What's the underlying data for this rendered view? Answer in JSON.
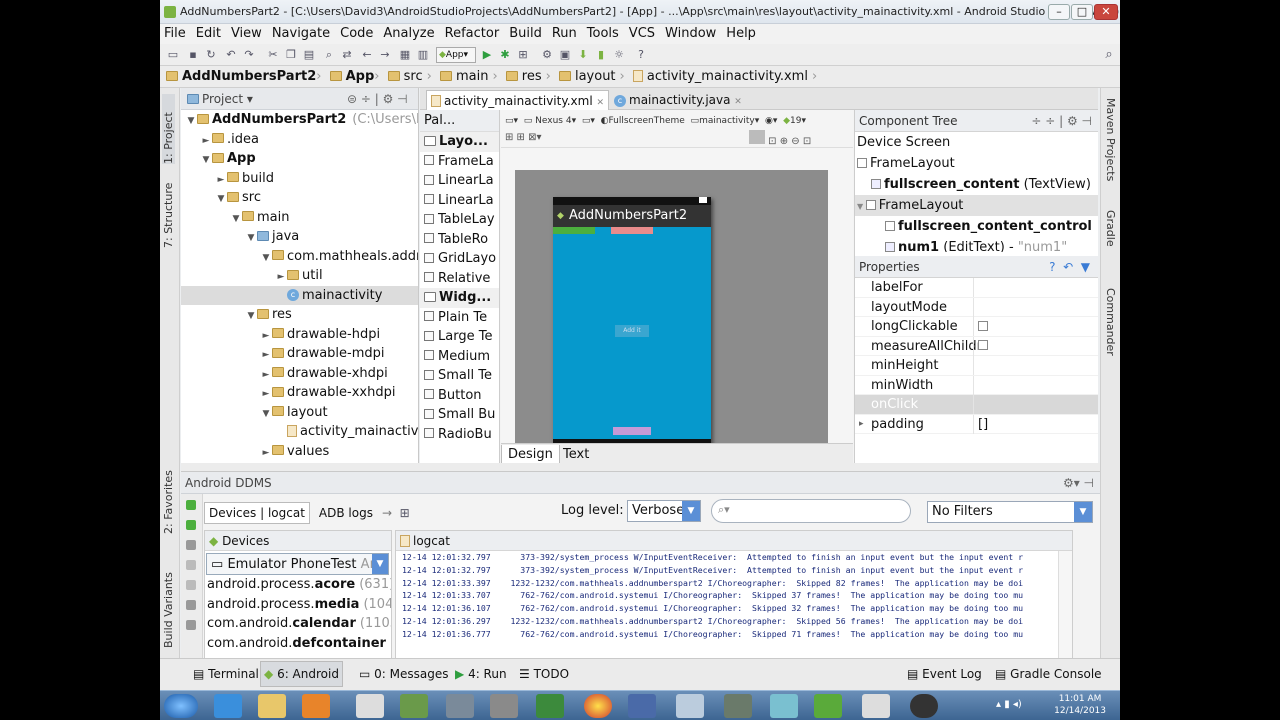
{
  "window": {
    "title": "AddNumbersPart2 - [C:\\Users\\David3\\AndroidStudioProjects\\AddNumbersPart2] - [App] - ...\\App\\src\\main\\res\\layout\\activity_mainactivity.xml - Android Studio (I/O Preview) 0.3.7"
  },
  "menu": [
    "File",
    "Edit",
    "View",
    "Navigate",
    "Code",
    "Analyze",
    "Refactor",
    "Build",
    "Run",
    "Tools",
    "VCS",
    "Window",
    "Help"
  ],
  "toolbar": {
    "run_config": "App"
  },
  "breadcrumb": [
    "AddNumbersPart2",
    "App",
    "src",
    "main",
    "res",
    "layout",
    "activity_mainactivity.xml"
  ],
  "left_tabs": {
    "project": "1: Project",
    "structure": "7: Structure",
    "favorites": "2: Favorites",
    "build_variants": "Build Variants"
  },
  "right_tabs": {
    "maven": "Maven Projects",
    "gradle": "Gradle",
    "commander": "Commander"
  },
  "project": {
    "header": "Project",
    "tree": [
      {
        "label": "AddNumbersPart2",
        "extra": "(C:\\Users\\D",
        "bold": true,
        "indent": 0,
        "arrow": "▼",
        "icon": "folder"
      },
      {
        "label": ".idea",
        "indent": 1,
        "arrow": "►",
        "icon": "folder"
      },
      {
        "label": "App",
        "bold": true,
        "indent": 1,
        "arrow": "▼",
        "icon": "folder"
      },
      {
        "label": "build",
        "indent": 2,
        "arrow": "►",
        "icon": "folder"
      },
      {
        "label": "src",
        "indent": 2,
        "arrow": "▼",
        "icon": "folder"
      },
      {
        "label": "main",
        "indent": 3,
        "arrow": "▼",
        "icon": "folder"
      },
      {
        "label": "java",
        "indent": 4,
        "arrow": "▼",
        "icon": "folder-blue"
      },
      {
        "label": "com.mathheals.addnu",
        "indent": 5,
        "arrow": "▼",
        "icon": "folder"
      },
      {
        "label": "util",
        "indent": 6,
        "arrow": "►",
        "icon": "folder"
      },
      {
        "label": "mainactivity",
        "indent": 6,
        "arrow": "",
        "icon": "class",
        "selected": true
      },
      {
        "label": "res",
        "indent": 4,
        "arrow": "▼",
        "icon": "folder"
      },
      {
        "label": "drawable-hdpi",
        "indent": 5,
        "arrow": "►",
        "icon": "folder"
      },
      {
        "label": "drawable-mdpi",
        "indent": 5,
        "arrow": "►",
        "icon": "folder"
      },
      {
        "label": "drawable-xhdpi",
        "indent": 5,
        "arrow": "►",
        "icon": "folder"
      },
      {
        "label": "drawable-xxhdpi",
        "indent": 5,
        "arrow": "►",
        "icon": "folder"
      },
      {
        "label": "layout",
        "indent": 5,
        "arrow": "▼",
        "icon": "folder"
      },
      {
        "label": "activity_mainactivit",
        "indent": 6,
        "arrow": "",
        "icon": "file"
      },
      {
        "label": "values",
        "indent": 5,
        "arrow": "►",
        "icon": "folder"
      }
    ]
  },
  "editor_tabs": [
    {
      "label": "activity_mainactivity.xml",
      "active": true
    },
    {
      "label": "mainactivity.java",
      "active": false
    }
  ],
  "palette": {
    "header": "Pal...",
    "rows": [
      {
        "label": "Layo...",
        "category": true
      },
      {
        "label": "FrameLa"
      },
      {
        "label": "LinearLa"
      },
      {
        "label": "LinearLa"
      },
      {
        "label": "TableLay"
      },
      {
        "label": "TableRo"
      },
      {
        "label": "GridLayo"
      },
      {
        "label": "Relative"
      },
      {
        "label": "Widg...",
        "category": true
      },
      {
        "label": "Plain Te"
      },
      {
        "label": "Large Te"
      },
      {
        "label": "Medium"
      },
      {
        "label": "Small Te"
      },
      {
        "label": "Button"
      },
      {
        "label": "Small Bu"
      },
      {
        "label": "RadioBu"
      }
    ]
  },
  "design_toolbar": {
    "device": "Nexus 4",
    "theme": "FullscreenTheme",
    "activity": "mainactivity",
    "api": "19"
  },
  "phone": {
    "app_title": "AddNumbersPart2",
    "button_label": "Add it"
  },
  "design_tabs": [
    "Design",
    "Text"
  ],
  "component_tree": {
    "header": "Component Tree",
    "rows": [
      {
        "label": "Device Screen",
        "indent": 0
      },
      {
        "label": "FrameLayout",
        "indent": 0,
        "checkbox": true
      },
      {
        "label": "fullscreen_content",
        "suffix": " (TextView)",
        "bold": true,
        "indent": 1
      },
      {
        "label": "FrameLayout",
        "indent": 0,
        "checkbox": true,
        "selected": true,
        "arrow": "▼"
      },
      {
        "label": "fullscreen_content_control",
        "bold": true,
        "indent": 2,
        "checkbox": true
      },
      {
        "label": "num1",
        "suffix": " (EditText) - ",
        "extra": "\"num1\"",
        "bold": true,
        "indent": 2
      }
    ]
  },
  "properties": {
    "header": "Properties",
    "rows": [
      {
        "name": "labelFor",
        "value": ""
      },
      {
        "name": "layoutMode",
        "value": ""
      },
      {
        "name": "longClickable",
        "value": "checkbox"
      },
      {
        "name": "measureAllChildr",
        "value": "checkbox"
      },
      {
        "name": "minHeight",
        "value": ""
      },
      {
        "name": "minWidth",
        "value": ""
      },
      {
        "name": "onClick",
        "value": "",
        "highlight": true
      },
      {
        "name": "padding",
        "value": "[]",
        "arrow": true
      }
    ]
  },
  "ddms": {
    "header": "Android DDMS",
    "tabs": [
      "Devices | logcat",
      "ADB logs"
    ],
    "log_level_label": "Log level:",
    "log_level": "Verbose",
    "filter": "No Filters",
    "devices_header": "Devices",
    "emulator": "Emulator PhoneTest",
    "emulator_extra": "And",
    "processes": [
      {
        "prefix": "android.process.",
        "bold": "acore",
        "pid": "(631)"
      },
      {
        "prefix": "android.process.",
        "bold": "media",
        "pid": "(104"
      },
      {
        "prefix": "com.android.",
        "bold": "calendar",
        "pid": "(1103"
      },
      {
        "prefix": "com.android.",
        "bold": "defcontainer",
        "pid": "("
      }
    ],
    "logcat_header": "logcat",
    "log_lines": [
      "12-14 12:01:32.797      373-392/system_process W/InputEventReceiver:  Attempted to finish an input event but the input event r",
      "12-14 12:01:32.797      373-392/system_process W/InputEventReceiver:  Attempted to finish an input event but the input event r",
      "12-14 12:01:33.397    1232-1232/com.mathheals.addnumberspart2 I/Choreographer:  Skipped 82 frames!  The application may be doi",
      "12-14 12:01:33.707      762-762/com.android.systemui I/Choreographer:  Skipped 37 frames!  The application may be doing too mu",
      "12-14 12:01:36.107      762-762/com.android.systemui I/Choreographer:  Skipped 32 frames!  The application may be doing too mu",
      "12-14 12:01:36.297    1232-1232/com.mathheals.addnumberspart2 I/Choreographer:  Skipped 56 frames!  The application may be doi",
      "12-14 12:01:36.777      762-762/com.android.systemui I/Choreographer:  Skipped 71 frames!  The application may be doing too mu"
    ]
  },
  "bottom_bar": {
    "terminal": "Terminal",
    "android": "6: Android",
    "messages": "0: Messages",
    "run": "4: Run",
    "todo": "TODO",
    "event_log": "Event Log",
    "gradle_console": "Gradle Console"
  },
  "taskbar": {
    "time": "11:01 AM",
    "date": "12/14/2013"
  }
}
